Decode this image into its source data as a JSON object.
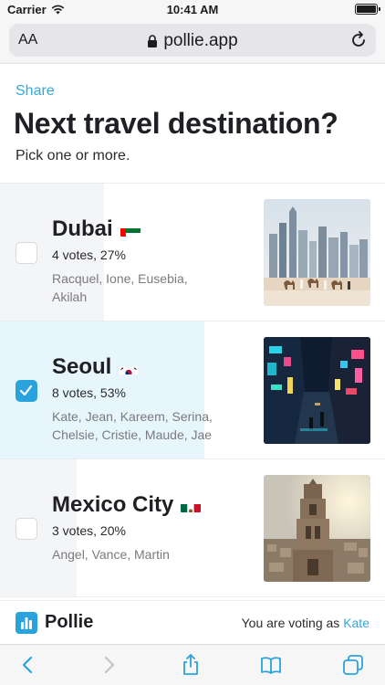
{
  "status_bar": {
    "carrier": "Carrier",
    "time": "10:41 AM"
  },
  "browser": {
    "text_size_label": "AA",
    "url": "pollie.app"
  },
  "page": {
    "share_label": "Share",
    "title": "Next travel destination?",
    "subtitle": "Pick one or more."
  },
  "options": [
    {
      "name": "Dubai",
      "flag": "uae-flag",
      "votes_text": "4 votes, 27%",
      "percent": 27,
      "voters": "Racquel, Ione, Eusebia, Akilah",
      "selected": false,
      "image": "dubai-skyline-with-camels"
    },
    {
      "name": "Seoul",
      "flag": "south-korea-flag",
      "votes_text": "8 votes, 53%",
      "percent": 53,
      "voters": "Kate, Jean, Kareem, Serina, Chelsie, Cristie, Maude, Jae",
      "selected": true,
      "image": "seoul-neon-street"
    },
    {
      "name": "Mexico City",
      "flag": "mexico-flag",
      "votes_text": "3 votes, 20%",
      "percent": 20,
      "voters": "Angel, Vance, Martin",
      "selected": false,
      "image": "mexico-city-cathedral-tower"
    }
  ],
  "footer": {
    "brand": "Pollie",
    "voting_as_prefix": "You are voting as",
    "voting_as_user": "Kate"
  },
  "colors": {
    "accent": "#2aa3dc",
    "link": "#34a8db",
    "selected_bar": "#e6f6fc",
    "result_bar": "#f4f5f7"
  },
  "toolbar": {
    "icons": [
      "back-icon",
      "forward-icon",
      "share-icon",
      "bookmarks-icon",
      "tabs-icon"
    ]
  }
}
